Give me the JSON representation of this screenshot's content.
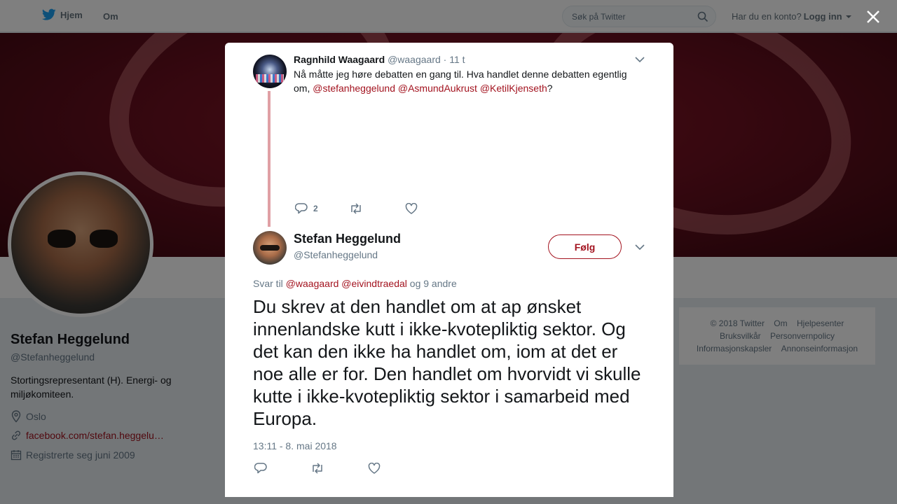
{
  "nav": {
    "home_label": "Hjem",
    "about_label": "Om",
    "search_placeholder": "Søk på Twitter",
    "account_question": "Har du en konto?",
    "login_label": "Logg inn",
    "brand_color": "#1da1f2"
  },
  "profile": {
    "name": "Stefan Heggelund",
    "handle": "@Stefanheggelund",
    "bio": "Stortingsrepresentant (H). Energi- og miljøkomiteen.",
    "location": "Oslo",
    "website": "facebook.com/stefan.heggelu…",
    "joined": "Registrerte seg juni 2009",
    "accent_color": "#a3131f"
  },
  "footer": {
    "items": [
      "© 2018 Twitter",
      "Om",
      "Hjelpesenter",
      "Bruksvilkår",
      "Personvernpolicy",
      "Informasjonskapsler",
      "Annonseinformasjon"
    ]
  },
  "modal": {
    "parent_tweet": {
      "name": "Ragnhild Waagaard",
      "handle": "@waagaard",
      "time": "· 11 t",
      "text_start": "Nå måtte jeg høre debatten en gang til. Hva handlet denne debatten egentlig om, ",
      "mentions": [
        "@stefanheggelund",
        "@AsmundAukrust",
        "@KetilKjenseth"
      ],
      "text_end": "?",
      "reply_count": "2"
    },
    "main_tweet": {
      "name": "Stefan Heggelund",
      "handle": "@Stefanheggelund",
      "follow_label": "Følg",
      "replying_prefix": "Svar til",
      "replying_mentions": [
        "@waagaard",
        "@eivindtraedal"
      ],
      "replying_suffix": "og 9 andre",
      "text": "Du skrev at den handlet om at ap ønsket innenlandske kutt i ikke-kvotepliktig sektor. Og det kan den ikke ha handlet om, iom at det er noe alle er for. Den handlet om hvorvidt vi skulle kutte i ikke-kvotepliktig sektor i samarbeid med Europa.",
      "timestamp": "13:11 - 8. mai 2018"
    }
  }
}
